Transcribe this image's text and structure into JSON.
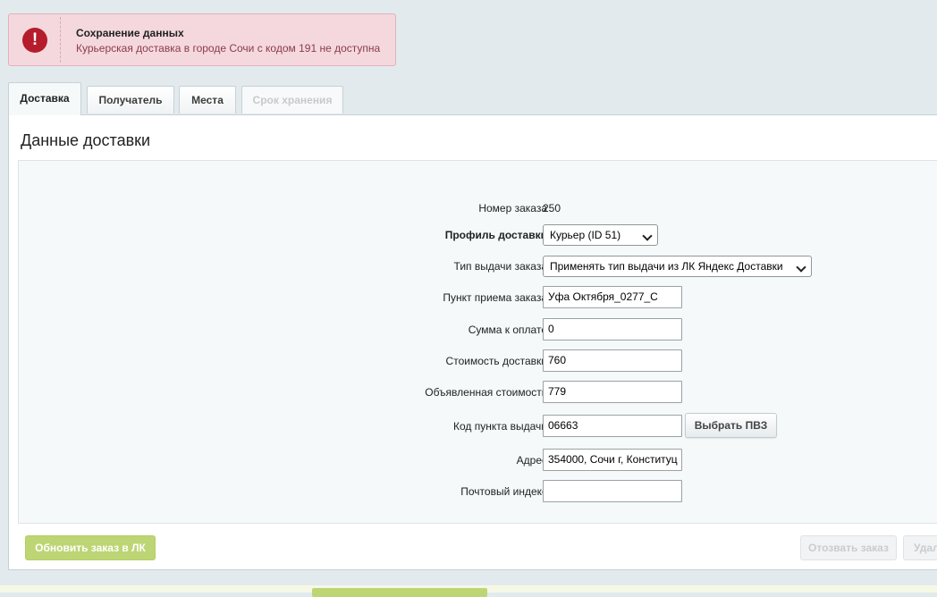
{
  "alert": {
    "title": "Сохранение данных",
    "message": "Курьерская доставка в городе Сочи с кодом 191 не доступна",
    "icon": "exclamation-icon",
    "color": "#b51d2c"
  },
  "tabs": [
    {
      "label": "Доставка",
      "state": "active"
    },
    {
      "label": "Получатель",
      "state": "normal"
    },
    {
      "label": "Места",
      "state": "normal"
    },
    {
      "label": "Срок хранения",
      "state": "disabled"
    }
  ],
  "panel": {
    "title": "Данные доставки"
  },
  "form": {
    "order_number_label": "Номер заказа",
    "order_number_value": "250",
    "profile_label": "Профиль доставки",
    "profile_value": "Курьер (ID 51)",
    "issue_type_label": "Тип выдачи заказа",
    "issue_type_value": "Применять тип выдачи из ЛК Яндекс Доставки",
    "pickup_point_label": "Пункт приема заказа",
    "pickup_point_value": "Уфа Октября_0277_С",
    "amount_label": "Сумма к оплате",
    "amount_value": "0",
    "delivery_cost_label": "Стоимость доставки",
    "delivery_cost_value": "760",
    "declared_value_label": "Объявленная стоимость",
    "declared_value_value": "779",
    "pvz_code_label": "Код пункта выдачи",
    "pvz_code_value": "06663",
    "choose_pvz_label": "Выбрать ПВЗ",
    "address_label": "Адрес",
    "address_value": "354000, Сочи г, Конституц",
    "postal_label": "Почтовый индекс",
    "postal_value": ""
  },
  "actions": {
    "update_label": "Обновить заказ в ЛК",
    "recall_label": "Отозвать заказ",
    "delete_label": "Удал"
  },
  "colors": {
    "accent_green": "#bdd574",
    "background": "#e3eaed"
  }
}
